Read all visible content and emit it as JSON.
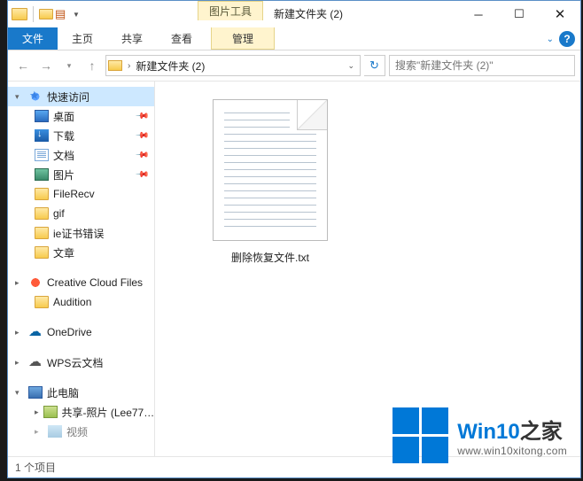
{
  "title": "新建文件夹 (2)",
  "contextTab": "图片工具",
  "ribbon": {
    "file": "文件",
    "home": "主页",
    "share": "共享",
    "view": "查看",
    "manage": "管理"
  },
  "breadcrumb": "新建文件夹 (2)",
  "searchPlaceholder": "搜索\"新建文件夹 (2)\"",
  "tree": {
    "quick": "快速访问",
    "desktop": "桌面",
    "downloads": "下载",
    "documents": "文档",
    "pictures": "图片",
    "filerecv": "FileRecv",
    "gif": "gif",
    "iecert": "ie证书错误",
    "articles": "文章",
    "cc": "Creative Cloud Files",
    "audition": "Audition",
    "onedrive": "OneDrive",
    "wps": "WPS云文档",
    "thispc": "此电脑",
    "shared": "共享-照片 (Lee77…",
    "video": "视频"
  },
  "file": {
    "name": "删除恢复文件.txt"
  },
  "status": "1 个项目",
  "watermark": {
    "brand_a": "Win10",
    "brand_b": "之家",
    "url": "www.win10xitong.com"
  }
}
